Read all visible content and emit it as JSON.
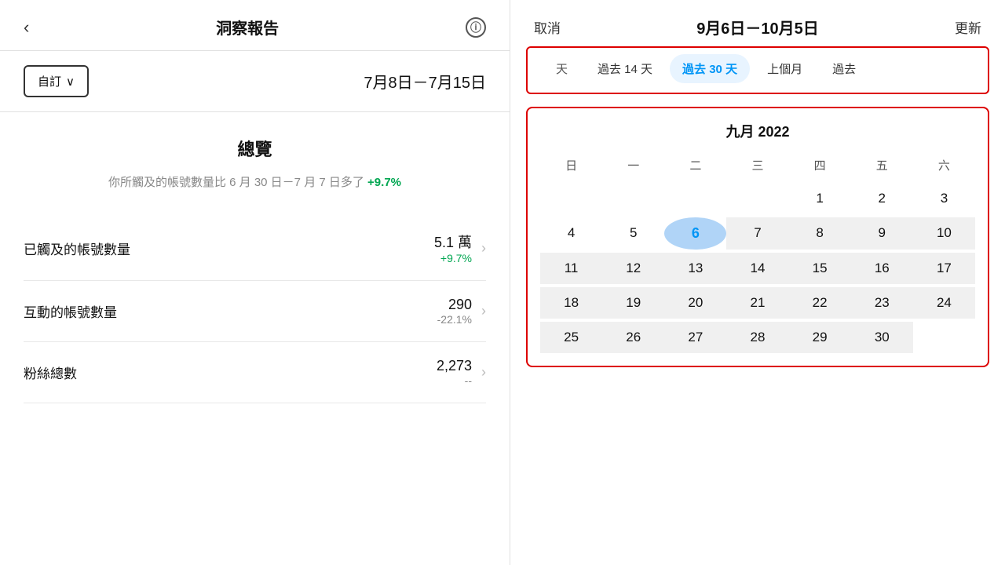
{
  "left": {
    "back_label": "‹",
    "title": "洞察報告",
    "info_icon": "ⓘ",
    "custom_btn": "自訂",
    "chevron_down": "∨",
    "date_range": "7月8日－7月15日",
    "overview": {
      "title": "總覽",
      "desc_prefix": "你所觸及的帳號數量比 6 月 30 日－7 月 7 日多了 ",
      "change": "+9.7%"
    },
    "stats": [
      {
        "label": "已觸及的帳號數量",
        "value": "5.1 萬",
        "change": "+9.7%",
        "type": "positive"
      },
      {
        "label": "互動的帳號數量",
        "value": "290",
        "change": "-22.1%",
        "type": "negative"
      },
      {
        "label": "粉絲總數",
        "value": "2,273",
        "change": "--",
        "type": "neutral"
      }
    ]
  },
  "right": {
    "cancel_label": "取消",
    "selected_range": "9月6日－10月5日",
    "update_label": "更新",
    "presets": [
      {
        "label": "天",
        "active": false
      },
      {
        "label": "過去 14 天",
        "active": false
      },
      {
        "label": "過去 30 天",
        "active": true
      },
      {
        "label": "上個月",
        "active": false
      },
      {
        "label": "過去",
        "active": false
      }
    ],
    "calendar": {
      "month_title": "九月 2022",
      "weekdays": [
        "日",
        "一",
        "二",
        "三",
        "四",
        "五",
        "六"
      ],
      "weeks": [
        [
          "",
          "",
          "",
          "",
          "1",
          "2",
          "3"
        ],
        [
          "4",
          "5",
          "6",
          "7",
          "8",
          "9",
          "10"
        ],
        [
          "11",
          "12",
          "13",
          "14",
          "15",
          "16",
          "17"
        ],
        [
          "18",
          "19",
          "20",
          "21",
          "22",
          "23",
          "24"
        ],
        [
          "25",
          "26",
          "27",
          "28",
          "29",
          "30",
          ""
        ]
      ],
      "selected_day": "6",
      "range_start": "6",
      "range_end": "30"
    }
  }
}
